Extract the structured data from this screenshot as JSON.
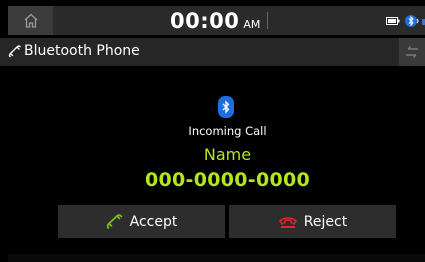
{
  "status_bar": {
    "time": "00:00",
    "ampm": "AM",
    "icons": [
      "home-icon",
      "battery-icon",
      "bluetooth-audio-icon"
    ]
  },
  "title_bar": {
    "title": "Bluetooth Phone",
    "icon": "phone-handset-icon",
    "back_icon": "back-arrow-icon"
  },
  "call": {
    "bt_icon": "bluetooth-icon",
    "status": "Incoming Call",
    "name": "Name",
    "number": "000-0000-0000"
  },
  "buttons": {
    "accept_label": "Accept",
    "reject_label": "Reject"
  },
  "colors": {
    "accent_green": "#b5e61d",
    "reject_red": "#e0262a",
    "bluetooth_blue": "#1d6fe0"
  }
}
